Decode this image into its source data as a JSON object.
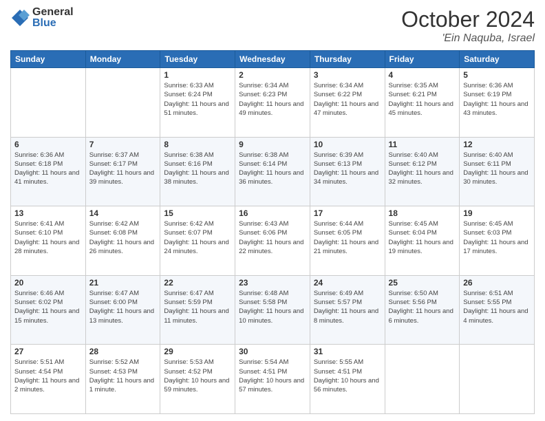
{
  "header": {
    "logo_general": "General",
    "logo_blue": "Blue",
    "month": "October 2024",
    "location": "'Ein Naquba, Israel"
  },
  "days_of_week": [
    "Sunday",
    "Monday",
    "Tuesday",
    "Wednesday",
    "Thursday",
    "Friday",
    "Saturday"
  ],
  "weeks": [
    [
      {
        "day": "",
        "info": ""
      },
      {
        "day": "",
        "info": ""
      },
      {
        "day": "1",
        "info": "Sunrise: 6:33 AM\nSunset: 6:24 PM\nDaylight: 11 hours and 51 minutes."
      },
      {
        "day": "2",
        "info": "Sunrise: 6:34 AM\nSunset: 6:23 PM\nDaylight: 11 hours and 49 minutes."
      },
      {
        "day": "3",
        "info": "Sunrise: 6:34 AM\nSunset: 6:22 PM\nDaylight: 11 hours and 47 minutes."
      },
      {
        "day": "4",
        "info": "Sunrise: 6:35 AM\nSunset: 6:21 PM\nDaylight: 11 hours and 45 minutes."
      },
      {
        "day": "5",
        "info": "Sunrise: 6:36 AM\nSunset: 6:19 PM\nDaylight: 11 hours and 43 minutes."
      }
    ],
    [
      {
        "day": "6",
        "info": "Sunrise: 6:36 AM\nSunset: 6:18 PM\nDaylight: 11 hours and 41 minutes."
      },
      {
        "day": "7",
        "info": "Sunrise: 6:37 AM\nSunset: 6:17 PM\nDaylight: 11 hours and 39 minutes."
      },
      {
        "day": "8",
        "info": "Sunrise: 6:38 AM\nSunset: 6:16 PM\nDaylight: 11 hours and 38 minutes."
      },
      {
        "day": "9",
        "info": "Sunrise: 6:38 AM\nSunset: 6:14 PM\nDaylight: 11 hours and 36 minutes."
      },
      {
        "day": "10",
        "info": "Sunrise: 6:39 AM\nSunset: 6:13 PM\nDaylight: 11 hours and 34 minutes."
      },
      {
        "day": "11",
        "info": "Sunrise: 6:40 AM\nSunset: 6:12 PM\nDaylight: 11 hours and 32 minutes."
      },
      {
        "day": "12",
        "info": "Sunrise: 6:40 AM\nSunset: 6:11 PM\nDaylight: 11 hours and 30 minutes."
      }
    ],
    [
      {
        "day": "13",
        "info": "Sunrise: 6:41 AM\nSunset: 6:10 PM\nDaylight: 11 hours and 28 minutes."
      },
      {
        "day": "14",
        "info": "Sunrise: 6:42 AM\nSunset: 6:08 PM\nDaylight: 11 hours and 26 minutes."
      },
      {
        "day": "15",
        "info": "Sunrise: 6:42 AM\nSunset: 6:07 PM\nDaylight: 11 hours and 24 minutes."
      },
      {
        "day": "16",
        "info": "Sunrise: 6:43 AM\nSunset: 6:06 PM\nDaylight: 11 hours and 22 minutes."
      },
      {
        "day": "17",
        "info": "Sunrise: 6:44 AM\nSunset: 6:05 PM\nDaylight: 11 hours and 21 minutes."
      },
      {
        "day": "18",
        "info": "Sunrise: 6:45 AM\nSunset: 6:04 PM\nDaylight: 11 hours and 19 minutes."
      },
      {
        "day": "19",
        "info": "Sunrise: 6:45 AM\nSunset: 6:03 PM\nDaylight: 11 hours and 17 minutes."
      }
    ],
    [
      {
        "day": "20",
        "info": "Sunrise: 6:46 AM\nSunset: 6:02 PM\nDaylight: 11 hours and 15 minutes."
      },
      {
        "day": "21",
        "info": "Sunrise: 6:47 AM\nSunset: 6:00 PM\nDaylight: 11 hours and 13 minutes."
      },
      {
        "day": "22",
        "info": "Sunrise: 6:47 AM\nSunset: 5:59 PM\nDaylight: 11 hours and 11 minutes."
      },
      {
        "day": "23",
        "info": "Sunrise: 6:48 AM\nSunset: 5:58 PM\nDaylight: 11 hours and 10 minutes."
      },
      {
        "day": "24",
        "info": "Sunrise: 6:49 AM\nSunset: 5:57 PM\nDaylight: 11 hours and 8 minutes."
      },
      {
        "day": "25",
        "info": "Sunrise: 6:50 AM\nSunset: 5:56 PM\nDaylight: 11 hours and 6 minutes."
      },
      {
        "day": "26",
        "info": "Sunrise: 6:51 AM\nSunset: 5:55 PM\nDaylight: 11 hours and 4 minutes."
      }
    ],
    [
      {
        "day": "27",
        "info": "Sunrise: 5:51 AM\nSunset: 4:54 PM\nDaylight: 11 hours and 2 minutes."
      },
      {
        "day": "28",
        "info": "Sunrise: 5:52 AM\nSunset: 4:53 PM\nDaylight: 11 hours and 1 minute."
      },
      {
        "day": "29",
        "info": "Sunrise: 5:53 AM\nSunset: 4:52 PM\nDaylight: 10 hours and 59 minutes."
      },
      {
        "day": "30",
        "info": "Sunrise: 5:54 AM\nSunset: 4:51 PM\nDaylight: 10 hours and 57 minutes."
      },
      {
        "day": "31",
        "info": "Sunrise: 5:55 AM\nSunset: 4:51 PM\nDaylight: 10 hours and 56 minutes."
      },
      {
        "day": "",
        "info": ""
      },
      {
        "day": "",
        "info": ""
      }
    ]
  ]
}
